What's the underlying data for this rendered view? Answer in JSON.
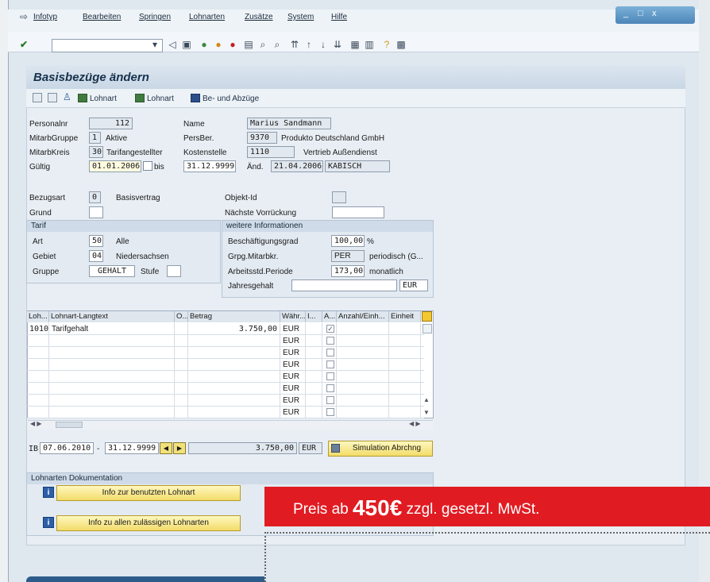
{
  "menu": [
    "Infotyp",
    "Bearbeiten",
    "Springen",
    "Lohnarten",
    "Zusätze",
    "System",
    "Hilfe"
  ],
  "window_controls": [
    "_",
    "□",
    "x"
  ],
  "page_title": "Basisbezüge ändern",
  "app_toolbar": {
    "btn1": "Lohnart",
    "btn2": "Lohnart",
    "btn3": "Be- und Abzüge"
  },
  "header": {
    "personalnr_label": "Personalnr",
    "personalnr": "112",
    "name_label": "Name",
    "name": "Marius Sandmann",
    "mitarbgruppe_label": "MitarbGruppe",
    "mitarbgruppe": "1",
    "mitarbgruppe_text": "Aktive",
    "persber_label": "PersBer.",
    "persber": "9370",
    "persber_text": "Produkto Deutschland GmbH",
    "mitarbkreis_label": "MitarbKreis",
    "mitarbkreis": "30",
    "mitarbkreis_text": "Tarifangestellter",
    "kostenstelle_label": "Kostenstelle",
    "kostenstelle": "1110",
    "kostenstelle_text": "Vertrieb Außendienst",
    "gueltig_label": "Gültig",
    "gueltig_von": "01.01.2006",
    "bis_label": "bis",
    "gueltig_bis": "31.12.9999",
    "aend_label": "Änd.",
    "aend_datum": "21.04.2006",
    "aend_user": "KABISCH"
  },
  "basis": {
    "bezugsart_label": "Bezugsart",
    "bezugsart": "0",
    "bezugsart_text": "Basisvertrag",
    "grund_label": "Grund",
    "objektid_label": "Objekt-Id",
    "naechste_label": "Nächste Vorrückung"
  },
  "tarif": {
    "title": "Tarif",
    "art_label": "Art",
    "art": "50",
    "art_text": "Alle",
    "gebiet_label": "Gebiet",
    "gebiet": "04",
    "gebiet_text": "Niedersachsen",
    "gruppe_label": "Gruppe",
    "gruppe": "GEHALT",
    "stufe_label": "Stufe"
  },
  "weitere": {
    "title": "weitere Informationen",
    "besch_label": "Beschäftigungsgrad",
    "besch": "100,00",
    "besch_unit": "%",
    "grpg_label": "Grpg.Mitarbkr.",
    "grpg": "PER",
    "grpg_text": "periodisch (G...",
    "arbeitsstd_label": "Arbeitsstd.Periode",
    "arbeitsstd": "173,00",
    "arbeitsstd_text": "monatlich",
    "jahres_label": "Jahresgehalt",
    "jahres_cur": "EUR"
  },
  "table": {
    "headers": [
      "Loh...",
      "Lohnart-Langtext",
      "O...",
      "Betrag",
      "Währ...",
      "I...",
      "A...",
      "Anzahl/Einh...",
      "Einheit"
    ],
    "rows": [
      {
        "lohnart": "1010",
        "text": "Tarifgehalt",
        "betrag": "3.750,00",
        "waehr": "EUR",
        "checked": "✓"
      },
      {
        "lohnart": "",
        "text": "",
        "betrag": "",
        "waehr": "EUR",
        "checked": ""
      },
      {
        "lohnart": "",
        "text": "",
        "betrag": "",
        "waehr": "EUR",
        "checked": ""
      },
      {
        "lohnart": "",
        "text": "",
        "betrag": "",
        "waehr": "EUR",
        "checked": ""
      },
      {
        "lohnart": "",
        "text": "",
        "betrag": "",
        "waehr": "EUR",
        "checked": ""
      },
      {
        "lohnart": "",
        "text": "",
        "betrag": "",
        "waehr": "EUR",
        "checked": ""
      },
      {
        "lohnart": "",
        "text": "",
        "betrag": "",
        "waehr": "EUR",
        "checked": ""
      },
      {
        "lohnart": "",
        "text": "",
        "betrag": "",
        "waehr": "EUR",
        "checked": ""
      }
    ]
  },
  "summary": {
    "ib_label": "IB",
    "von": "07.06.2010",
    "dash": "-",
    "bis": "31.12.9999",
    "betrag": "3.750,00",
    "waehr": "EUR",
    "sim_button": "Simulation Abrchng"
  },
  "doku": {
    "title": "Lohnarten Dokumentation",
    "btn1": "Info zur benutzten Lohnart",
    "btn2": "Info zu allen zulässigen Lohnarten"
  },
  "promo": {
    "prefix": "Preis ab",
    "price": "450€",
    "suffix": "zzgl. gesetzl. MwSt."
  },
  "colors": {
    "promo_red": "#e11b22",
    "sap_blue": "#2e5c8a",
    "button_yellow": "#f2dc6a"
  }
}
